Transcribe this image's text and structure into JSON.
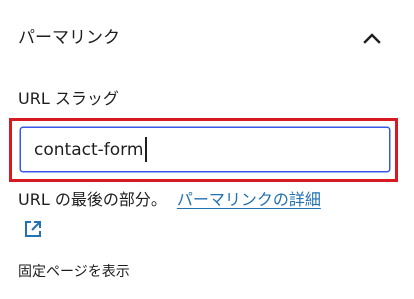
{
  "panel": {
    "title": "パーマリンク",
    "toggle_icon": "chevron-up-icon"
  },
  "slug": {
    "label": "URL スラッグ",
    "value": "contact-form",
    "highlight_color": "#d71921",
    "focus_color": "#3858e9"
  },
  "help": {
    "text": "URL の最後の部分。",
    "link_text": "パーマリンクの詳細",
    "link_color": "#2271b1",
    "external_icon": "external-link-icon"
  },
  "view_page": {
    "label": "固定ページを表示"
  }
}
